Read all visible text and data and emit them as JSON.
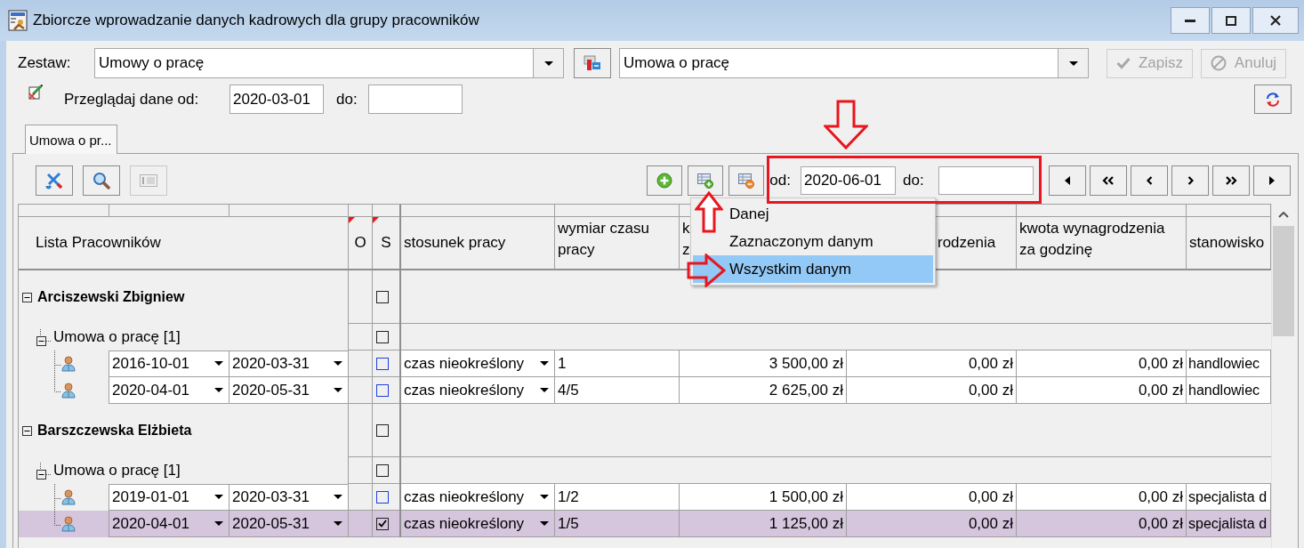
{
  "window": {
    "title": "Zbiorcze wprowadzanie danych kadrowych dla grupy pracowników"
  },
  "set_row": {
    "label": "Zestaw:",
    "set": "Umowy o pracę",
    "template": "Umowa o pracę",
    "buttons": [
      {
        "kind": "save",
        "label": "Zapisz",
        "disabled": true
      },
      {
        "kind": "cancel",
        "label": "Anuluj",
        "disabled": true
      }
    ]
  },
  "browse": {
    "label": "Przeglądaj dane od:",
    "from": "2020-03-01",
    "to_label": "do:"
  },
  "tabs": [
    {
      "label": "Umowa o pr...",
      "selected": true
    }
  ],
  "toolbar": {
    "left_buttons": [
      {
        "kind": "tools",
        "disabled": false
      },
      {
        "kind": "search",
        "disabled": false
      },
      {
        "kind": "numbering",
        "disabled": true
      }
    ],
    "right_buttons": [
      {
        "kind": "add"
      },
      {
        "kind": "add_rows"
      },
      {
        "kind": "remove_rows"
      }
    ],
    "from_label": "od:",
    "from": "2020-06-01",
    "to_label": "do:",
    "nav_buttons": [
      {
        "kind": "start"
      },
      {
        "kind": "first"
      },
      {
        "kind": "previous"
      },
      {
        "kind": "next"
      },
      {
        "kind": "last"
      },
      {
        "kind": "end"
      }
    ]
  },
  "menu": {
    "items": [
      {
        "label": "Danej",
        "selected": false
      },
      {
        "label": "Zaznaczonym danym",
        "selected": false
      },
      {
        "label": "Wszystkim danym",
        "selected": true
      }
    ]
  },
  "table": {
    "tree_header": "Lista Pracowników",
    "columns": [
      {
        "lines": [
          "O"
        ],
        "flag": true
      },
      {
        "lines": [
          "S"
        ],
        "flag": true
      },
      {
        "lines": [
          "stosunek pracy"
        ],
        "flag": false
      },
      {
        "lines": [
          "wymiar czasu",
          "pracy"
        ],
        "flag": false
      },
      {
        "lines": [
          "k",
          "z"
        ],
        "flag": false
      },
      {
        "lines": [
          "rodzenia"
        ],
        "flag": false
      },
      {
        "lines": [
          "kwota wynagrodzenia",
          "za godzinę"
        ],
        "flag": false
      },
      {
        "lines": [
          "stanowisko"
        ],
        "flag": false
      }
    ],
    "groups": [
      {
        "name": "Arciszewski Zbigniew",
        "expanded": true,
        "checked": false,
        "children": [
          {
            "name": "Umowa o pracę [1]",
            "expanded": true,
            "checked": false,
            "children": [
              {
                "date_from": "2016-10-01",
                "date_to": "2020-03-31",
                "checked": false,
                "selected": false,
                "employment_type": "czas nieokreślony",
                "working_time": "1",
                "column_5": "3 500,00 zł",
                "column_6": "0,00 zł",
                "hourly_rate": "0,00 zł",
                "position": "handlowiec"
              },
              {
                "date_from": "2020-04-01",
                "date_to": "2020-05-31",
                "checked": false,
                "selected": false,
                "employment_type": "czas nieokreślony",
                "working_time": "4/5",
                "column_5": "2 625,00 zł",
                "column_6": "0,00 zł",
                "hourly_rate": "0,00 zł",
                "position": "handlowiec"
              }
            ]
          }
        ]
      },
      {
        "name": "Barszczewska Elżbieta",
        "expanded": true,
        "checked": false,
        "children": [
          {
            "name": "Umowa o pracę [1]",
            "expanded": true,
            "checked": false,
            "children": [
              {
                "date_from": "2019-01-01",
                "date_to": "2020-03-31",
                "checked": false,
                "selected": false,
                "employment_type": "czas nieokreślony",
                "working_time": "1/2",
                "column_5": "1 500,00 zł",
                "column_6": "0,00 zł",
                "hourly_rate": "0,00 zł",
                "position": "specjalista d"
              },
              {
                "date_from": "2020-04-01",
                "date_to": "2020-05-31",
                "checked": true,
                "selected": true,
                "employment_type": "czas nieokreślony",
                "working_time": "1/5",
                "column_5": "1 125,00 zł",
                "column_6": "0,00 zł",
                "hourly_rate": "0,00 zł",
                "position": "specjalista d"
              }
            ]
          }
        ]
      }
    ]
  }
}
